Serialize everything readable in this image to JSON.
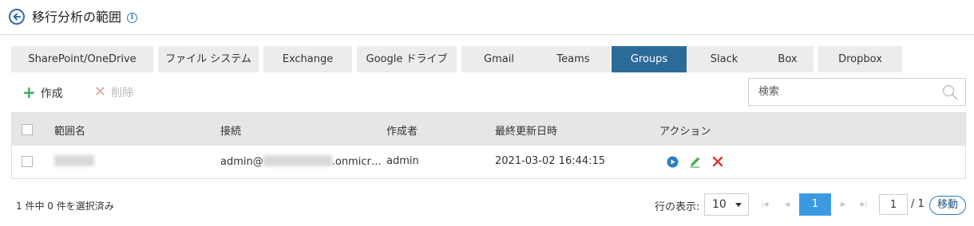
{
  "header": {
    "title": "移行分析の範囲",
    "info_glyph": "i"
  },
  "tabs": [
    {
      "label": "SharePoint/OneDrive",
      "active": false
    },
    {
      "label": "ファイル システム",
      "active": false
    },
    {
      "label": "Exchange",
      "active": false
    },
    {
      "label": "Google ドライブ",
      "active": false
    },
    {
      "label": "Gmail",
      "active": false
    },
    {
      "label": "Teams",
      "active": false
    },
    {
      "label": "Groups",
      "active": true
    },
    {
      "label": "Slack",
      "active": false
    },
    {
      "label": "Box",
      "active": false
    },
    {
      "label": "Dropbox",
      "active": false
    }
  ],
  "toolbar": {
    "create_label": "作成",
    "delete_label": "削除",
    "search_placeholder": "検索"
  },
  "table": {
    "columns": [
      "範囲名",
      "接続",
      "作成者",
      "最終更新日時",
      "アクション"
    ],
    "rows": [
      {
        "connection_prefix": "admin@",
        "connection_suffix": ".onmicr…",
        "creator": "admin",
        "modified": "2021-03-02 16:44:15",
        "actions": [
          "play-icon",
          "edit-icon",
          "delete-icon"
        ]
      }
    ]
  },
  "footer": {
    "status": "1 件中 0 件を選択済み",
    "rows_label": "行の表示:",
    "rows_per_page": "10",
    "current_page": "1",
    "page_input": "1",
    "page_total": "/ 1",
    "go_label": "移動"
  },
  "colors": {
    "active_tab": "#2b6b99",
    "accent": "#3b9adf",
    "create": "#3aa757",
    "delete": "#d9363e"
  }
}
